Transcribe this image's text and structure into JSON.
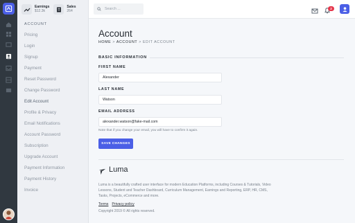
{
  "stats": {
    "earnings": {
      "label": "Earnings",
      "value": "$12.3k",
      "icon": "trending-up-icon"
    },
    "sales": {
      "label": "Sales",
      "value": "264",
      "icon": "receipt-icon"
    }
  },
  "submenu": {
    "heading": "ACCOUNT",
    "items": [
      "Pricing",
      "Login",
      "Signup",
      "Payment",
      "Reset Password",
      "Change Password",
      "Edit Account",
      "Profile & Privacy",
      "Email Notifications",
      "Account Password",
      "Subscription",
      "Upgrade Account",
      "Payment Information",
      "Payment History",
      "Invoice"
    ]
  },
  "topbar": {
    "search_placeholder": "Search ...",
    "notification_count": "2"
  },
  "page": {
    "title": "Account",
    "breadcrumb": {
      "home": "HOME",
      "sep": ">",
      "account": "ACCOUNT",
      "current": "EDIT ACCOUNT"
    }
  },
  "form": {
    "section_title": "BASIC INFORMATION",
    "first_name_label": "FIRST NAME",
    "first_name_value": "Alexander",
    "last_name_label": "LAST NAME",
    "last_name_value": "Watson",
    "email_label": "EMAIL ADDRESS",
    "email_value": "alexander.watson@fake-mail.com",
    "email_note": "Note that if you change your email, you will have to confirm it again.",
    "save_label": "SAVE CHANGES"
  },
  "footer": {
    "brand": "Luma",
    "description": "Luma is a beautifully crafted user interface for modern Education Platforms, including Courses & Tutorials, Video Lessons, Student and Teacher Dashboard, Curriculum Management, Earnings and Reporting, ERP, HR, CMS, Tasks, Projects, eCommerce and more.",
    "terms": "Terms",
    "privacy": "Privacy policy",
    "copyright": "Copyright 2019 © All rights reserved."
  },
  "colors": {
    "accent": "#4b5fe6",
    "rail": "#303840",
    "badge": "#e5364b"
  }
}
